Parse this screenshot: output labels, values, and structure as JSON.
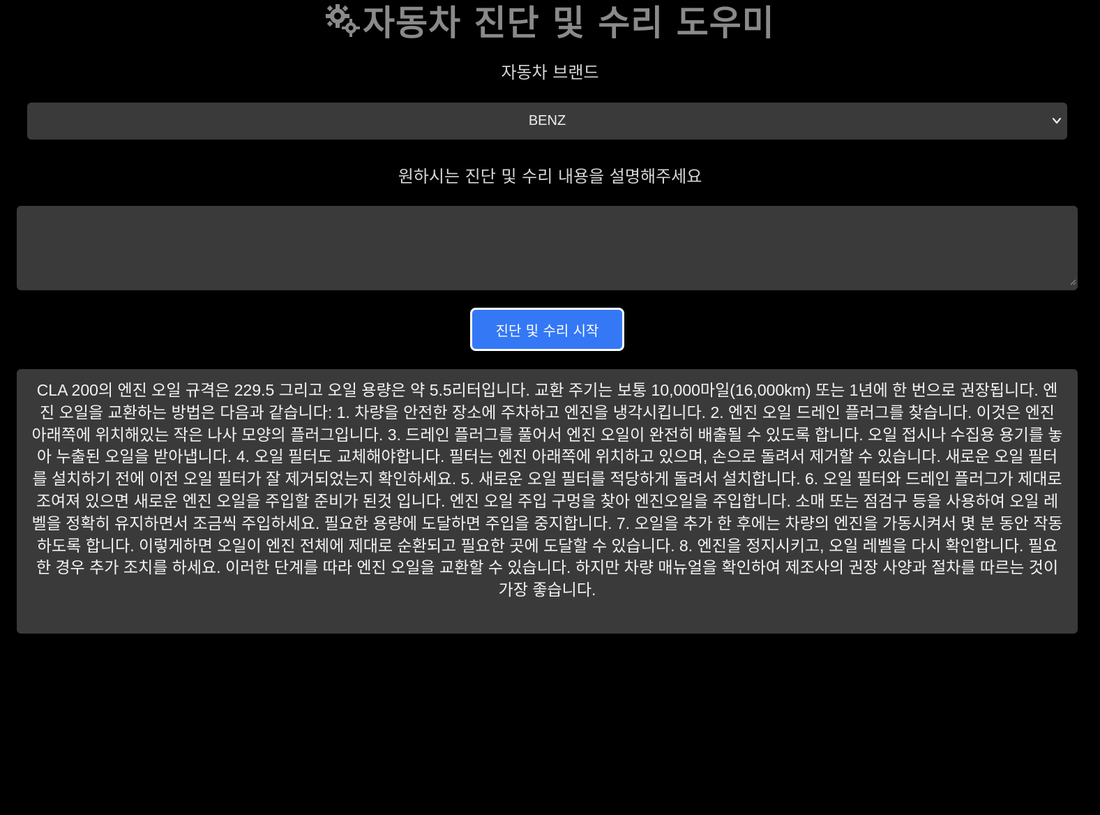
{
  "header": {
    "title": "자동차 진단 및 수리 도우미",
    "icon": "gears-icon"
  },
  "brand": {
    "label": "자동차 브랜드",
    "selected": "BENZ"
  },
  "description": {
    "label": "원하시는 진단 및 수리 내용을 설명해주세요",
    "value": ""
  },
  "actions": {
    "start_label": "진단 및 수리 시작"
  },
  "result": {
    "text": "CLA 200의 엔진 오일 규격은 229.5 그리고 오일 용량은 약 5.5리터입니다. 교환 주기는 보통 10,000마일(16,000km) 또는 1년에 한 번으로 권장됩니다. 엔진 오일을 교환하는 방법은 다음과 같습니다: 1. 차량을 안전한 장소에 주차하고 엔진을 냉각시킵니다. 2. 엔진 오일 드레인 플러그를 찾습니다. 이것은 엔진 아래쪽에 위치해있는 작은 나사 모양의 플러그입니다. 3. 드레인 플러그를 풀어서 엔진 오일이 완전히 배출될 수 있도록 합니다. 오일 접시나 수집용 용기를 놓아 누출된 오일을 받아냅니다. 4. 오일 필터도 교체해야합니다. 필터는 엔진 아래쪽에 위치하고 있으며, 손으로 돌려서 제거할 수 있습니다. 새로운 오일 필터를 설치하기 전에 이전 오일 필터가 잘 제거되었는지 확인하세요. 5. 새로운 오일 필터를 적당하게 돌려서 설치합니다. 6. 오일 필터와 드레인 플러그가 제대로 조여져 있으면 새로운 엔진 오일을 주입할 준비가 된것 입니다. 엔진 오일 주입 구멍을 찾아 엔진오일을 주입합니다. 소매 또는 점검구 등을 사용하여 오일 레벨을 정확히 유지하면서 조금씩 주입하세요. 필요한 용량에 도달하면 주입을 중지합니다. 7. 오일을 추가 한 후에는 차량의 엔진을 가동시켜서 몇 분 동안 작동하도록 합니다. 이렇게하면 오일이 엔진 전체에 제대로 순환되고 필요한 곳에 도달할 수 있습니다. 8. 엔진을 정지시키고, 오일 레벨을 다시 확인합니다. 필요한 경우 추가 조치를 하세요. 이러한 단계를 따라 엔진 오일을 교환할 수 있습니다. 하지만 차량 매뉴얼을 확인하여 제조사의 권장 사양과 절차를 따르는 것이 가장 좋습니다."
  }
}
